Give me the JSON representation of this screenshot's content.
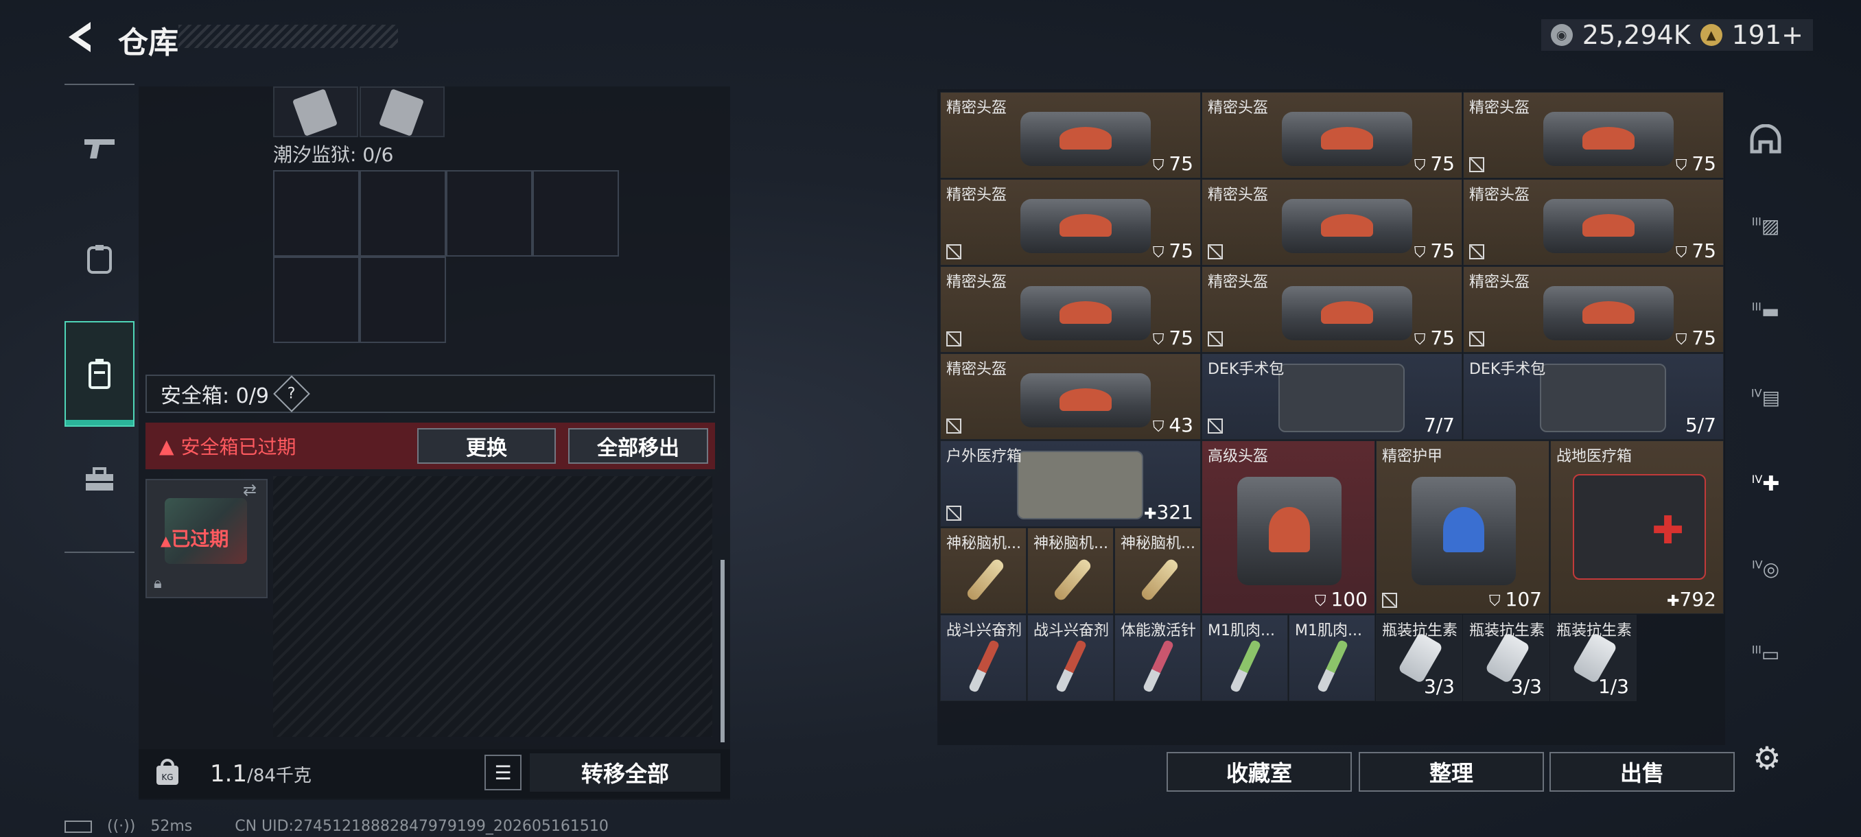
{
  "header": {
    "title": "仓库",
    "currency_silver": "25,294K",
    "currency_gold": "191+"
  },
  "left": {
    "prison_label": "潮汐监狱: 0/6",
    "safebox_label": "安全箱: 0/9",
    "safebox_help": "?",
    "expired_warning": "安全箱已过期",
    "replace_button": "更换",
    "move_all_out_button": "全部移出",
    "case_status": "已过期",
    "weight_value": "1.1",
    "weight_max": "/84千克",
    "transfer_all_button": "转移全部"
  },
  "status": {
    "ping": "52ms",
    "uid": "CN UID:274512188828479791​99_202605161510"
  },
  "inventory": [
    {
      "name": "精密头盔",
      "value": "75",
      "kind": "helmet",
      "no_trade": false
    },
    {
      "name": "精密头盔",
      "value": "75",
      "kind": "helmet",
      "no_trade": false
    },
    {
      "name": "精密头盔",
      "value": "75",
      "kind": "helmet",
      "no_trade": true
    },
    {
      "name": "精密头盔",
      "value": "75",
      "kind": "helmet",
      "no_trade": true
    },
    {
      "name": "精密头盔",
      "value": "75",
      "kind": "helmet",
      "no_trade": true
    },
    {
      "name": "精密头盔",
      "value": "75",
      "kind": "helmet",
      "no_trade": true
    },
    {
      "name": "精密头盔",
      "value": "75",
      "kind": "helmet",
      "no_trade": true
    },
    {
      "name": "精密头盔",
      "value": "75",
      "kind": "helmet",
      "no_trade": true
    },
    {
      "name": "精密头盔",
      "value": "75",
      "kind": "helmet",
      "no_trade": true
    },
    {
      "name": "精密头盔",
      "value": "43",
      "kind": "helmet",
      "no_trade": true
    },
    {
      "name": "DEK手术包",
      "value": "7/7",
      "kind": "kit",
      "no_trade": true
    },
    {
      "name": "DEK手术包",
      "value": "5/7",
      "kind": "kit",
      "no_trade": false
    },
    {
      "name": "户外医疗箱",
      "value": "321",
      "kind": "medbox",
      "no_trade": true
    },
    {
      "name": "高级头盔",
      "value": "100",
      "kind": "bighelmet",
      "no_trade": false
    },
    {
      "name": "精密护甲",
      "value": "107",
      "kind": "armor",
      "no_trade": true
    },
    {
      "name": "战地医疗箱",
      "value": "792",
      "kind": "firstaid",
      "no_trade": false
    },
    {
      "name": "神秘脑机...",
      "value": "",
      "kind": "chip",
      "no_trade": false
    },
    {
      "name": "神秘脑机...",
      "value": "",
      "kind": "chip",
      "no_trade": false
    },
    {
      "name": "神秘脑机...",
      "value": "",
      "kind": "chip",
      "no_trade": false
    },
    {
      "name": "战斗兴奋剂",
      "value": "",
      "kind": "syringe-red",
      "no_trade": false
    },
    {
      "name": "战斗兴奋剂",
      "value": "",
      "kind": "syringe-red",
      "no_trade": false
    },
    {
      "name": "体能激活针",
      "value": "",
      "kind": "syringe-pink",
      "no_trade": false
    },
    {
      "name": "M1肌肉...",
      "value": "",
      "kind": "syringe-green",
      "no_trade": false
    },
    {
      "name": "M1肌肉...",
      "value": "",
      "kind": "syringe-green",
      "no_trade": false
    },
    {
      "name": "瓶装抗生素",
      "value": "3/3",
      "kind": "bottle",
      "no_trade": false
    },
    {
      "name": "瓶装抗生素",
      "value": "3/3",
      "kind": "bottle",
      "no_trade": false
    },
    {
      "name": "瓶装抗生素",
      "value": "1/3",
      "kind": "bottle",
      "no_trade": false
    }
  ],
  "bottom_buttons": {
    "collection": "收藏室",
    "sort": "整理",
    "sell": "出售"
  },
  "right_sidebar": {
    "labels": [
      "",
      "III",
      "III",
      "IV",
      "IV",
      "IV",
      "III"
    ]
  }
}
